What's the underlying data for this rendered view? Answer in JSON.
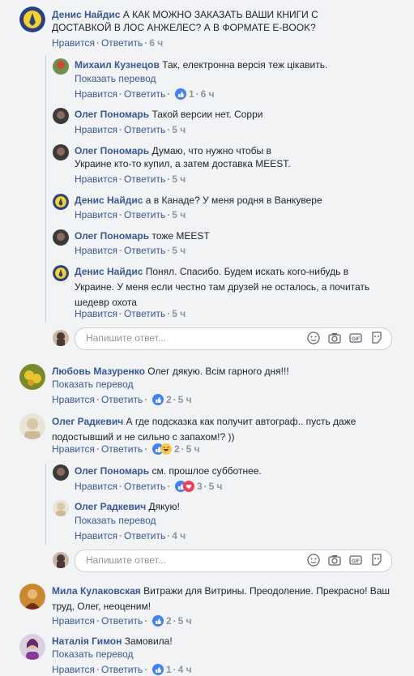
{
  "actions": {
    "like": "Нравится",
    "reply": "Ответить",
    "sep": "·"
  },
  "translate": "Показать перевод",
  "reply_placeholder": "Напишите ответ...",
  "comments": [
    {
      "name": "Денис Найдис",
      "text": "А КАК МОЖНО ЗАКАЗАТЬ ВАШИ КНИГИ С ДОСТАВКОЙ В ЛОС АНЖЕЛЕС? А В ФОРМАТЕ E-BOOK?",
      "time": "6 ч"
    },
    {
      "name": "Михаил Кузнецов",
      "text": "Так, електронна версія теж цікавить.",
      "translate": "Показать перевод",
      "count": "1",
      "time": "6 ч"
    },
    {
      "name": "Олег Пономарь",
      "text": "Такой версии нет. Сорри",
      "time": "5 ч"
    },
    {
      "name": "Олег Пономарь",
      "text": "Думаю, что нужно чтобы в Украине кто-то купил, а затем доставка MEEST.",
      "time": "5 ч"
    },
    {
      "name": "Денис Найдис",
      "text": "а в Канаде? У меня родня в Ванкувере",
      "time": "5 ч"
    },
    {
      "name": "Олег Пономарь",
      "text": "тоже MEEST",
      "time": "5 ч"
    },
    {
      "name": "Денис Найдис",
      "text": "Понял. Спасибо. Будем искать кого-нибудь в Украине. У меня если честно там друзей не осталось, а почитать шедевр охота",
      "time": "5 ч"
    },
    {
      "name": "Любовь Мазуренко",
      "text": "Олег дякую. Всім гарного дня!!!",
      "translate": "Показать перевод",
      "count": "2",
      "time": "5 ч"
    },
    {
      "name": "Олег Радкевич",
      "text": "А где подсказка как получит автограф.. пусть даже подостывший и не сильно с запахом!? ))",
      "count": "2",
      "time": "5 ч"
    },
    {
      "name": "Олег Пономарь",
      "text": "см. прошлое субботнее.",
      "count": "3",
      "time": "5 ч"
    },
    {
      "name": "Олег Радкевич",
      "text": "Дякую!",
      "translate": "Показать перевод",
      "time": "4 ч"
    },
    {
      "name": "Мила Кулаковская",
      "text": "Витражи для Витрины. Преодоление. Прекрасно! Ваш труд, Олег, неоценим!",
      "count": "2",
      "time": "5 ч"
    },
    {
      "name": "Наталія Гимон",
      "text": "Замовила!",
      "translate": "Показать перевод",
      "count": "1",
      "time": "4 ч"
    }
  ]
}
